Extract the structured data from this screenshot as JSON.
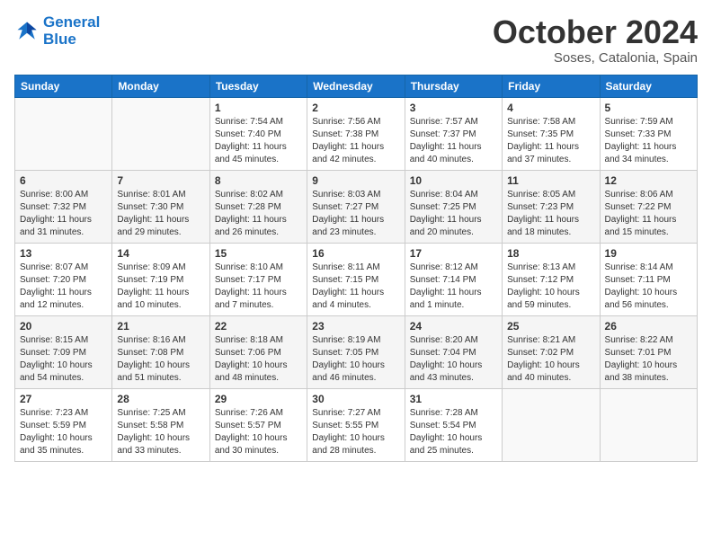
{
  "header": {
    "logo_line1": "General",
    "logo_line2": "Blue",
    "month": "October 2024",
    "location": "Soses, Catalonia, Spain"
  },
  "weekdays": [
    "Sunday",
    "Monday",
    "Tuesday",
    "Wednesday",
    "Thursday",
    "Friday",
    "Saturday"
  ],
  "weeks": [
    [
      {
        "day": "",
        "info": ""
      },
      {
        "day": "",
        "info": ""
      },
      {
        "day": "1",
        "info": "Sunrise: 7:54 AM\nSunset: 7:40 PM\nDaylight: 11 hours\nand 45 minutes."
      },
      {
        "day": "2",
        "info": "Sunrise: 7:56 AM\nSunset: 7:38 PM\nDaylight: 11 hours\nand 42 minutes."
      },
      {
        "day": "3",
        "info": "Sunrise: 7:57 AM\nSunset: 7:37 PM\nDaylight: 11 hours\nand 40 minutes."
      },
      {
        "day": "4",
        "info": "Sunrise: 7:58 AM\nSunset: 7:35 PM\nDaylight: 11 hours\nand 37 minutes."
      },
      {
        "day": "5",
        "info": "Sunrise: 7:59 AM\nSunset: 7:33 PM\nDaylight: 11 hours\nand 34 minutes."
      }
    ],
    [
      {
        "day": "6",
        "info": "Sunrise: 8:00 AM\nSunset: 7:32 PM\nDaylight: 11 hours\nand 31 minutes."
      },
      {
        "day": "7",
        "info": "Sunrise: 8:01 AM\nSunset: 7:30 PM\nDaylight: 11 hours\nand 29 minutes."
      },
      {
        "day": "8",
        "info": "Sunrise: 8:02 AM\nSunset: 7:28 PM\nDaylight: 11 hours\nand 26 minutes."
      },
      {
        "day": "9",
        "info": "Sunrise: 8:03 AM\nSunset: 7:27 PM\nDaylight: 11 hours\nand 23 minutes."
      },
      {
        "day": "10",
        "info": "Sunrise: 8:04 AM\nSunset: 7:25 PM\nDaylight: 11 hours\nand 20 minutes."
      },
      {
        "day": "11",
        "info": "Sunrise: 8:05 AM\nSunset: 7:23 PM\nDaylight: 11 hours\nand 18 minutes."
      },
      {
        "day": "12",
        "info": "Sunrise: 8:06 AM\nSunset: 7:22 PM\nDaylight: 11 hours\nand 15 minutes."
      }
    ],
    [
      {
        "day": "13",
        "info": "Sunrise: 8:07 AM\nSunset: 7:20 PM\nDaylight: 11 hours\nand 12 minutes."
      },
      {
        "day": "14",
        "info": "Sunrise: 8:09 AM\nSunset: 7:19 PM\nDaylight: 11 hours\nand 10 minutes."
      },
      {
        "day": "15",
        "info": "Sunrise: 8:10 AM\nSunset: 7:17 PM\nDaylight: 11 hours\nand 7 minutes."
      },
      {
        "day": "16",
        "info": "Sunrise: 8:11 AM\nSunset: 7:15 PM\nDaylight: 11 hours\nand 4 minutes."
      },
      {
        "day": "17",
        "info": "Sunrise: 8:12 AM\nSunset: 7:14 PM\nDaylight: 11 hours\nand 1 minute."
      },
      {
        "day": "18",
        "info": "Sunrise: 8:13 AM\nSunset: 7:12 PM\nDaylight: 10 hours\nand 59 minutes."
      },
      {
        "day": "19",
        "info": "Sunrise: 8:14 AM\nSunset: 7:11 PM\nDaylight: 10 hours\nand 56 minutes."
      }
    ],
    [
      {
        "day": "20",
        "info": "Sunrise: 8:15 AM\nSunset: 7:09 PM\nDaylight: 10 hours\nand 54 minutes."
      },
      {
        "day": "21",
        "info": "Sunrise: 8:16 AM\nSunset: 7:08 PM\nDaylight: 10 hours\nand 51 minutes."
      },
      {
        "day": "22",
        "info": "Sunrise: 8:18 AM\nSunset: 7:06 PM\nDaylight: 10 hours\nand 48 minutes."
      },
      {
        "day": "23",
        "info": "Sunrise: 8:19 AM\nSunset: 7:05 PM\nDaylight: 10 hours\nand 46 minutes."
      },
      {
        "day": "24",
        "info": "Sunrise: 8:20 AM\nSunset: 7:04 PM\nDaylight: 10 hours\nand 43 minutes."
      },
      {
        "day": "25",
        "info": "Sunrise: 8:21 AM\nSunset: 7:02 PM\nDaylight: 10 hours\nand 40 minutes."
      },
      {
        "day": "26",
        "info": "Sunrise: 8:22 AM\nSunset: 7:01 PM\nDaylight: 10 hours\nand 38 minutes."
      }
    ],
    [
      {
        "day": "27",
        "info": "Sunrise: 7:23 AM\nSunset: 5:59 PM\nDaylight: 10 hours\nand 35 minutes."
      },
      {
        "day": "28",
        "info": "Sunrise: 7:25 AM\nSunset: 5:58 PM\nDaylight: 10 hours\nand 33 minutes."
      },
      {
        "day": "29",
        "info": "Sunrise: 7:26 AM\nSunset: 5:57 PM\nDaylight: 10 hours\nand 30 minutes."
      },
      {
        "day": "30",
        "info": "Sunrise: 7:27 AM\nSunset: 5:55 PM\nDaylight: 10 hours\nand 28 minutes."
      },
      {
        "day": "31",
        "info": "Sunrise: 7:28 AM\nSunset: 5:54 PM\nDaylight: 10 hours\nand 25 minutes."
      },
      {
        "day": "",
        "info": ""
      },
      {
        "day": "",
        "info": ""
      }
    ]
  ]
}
